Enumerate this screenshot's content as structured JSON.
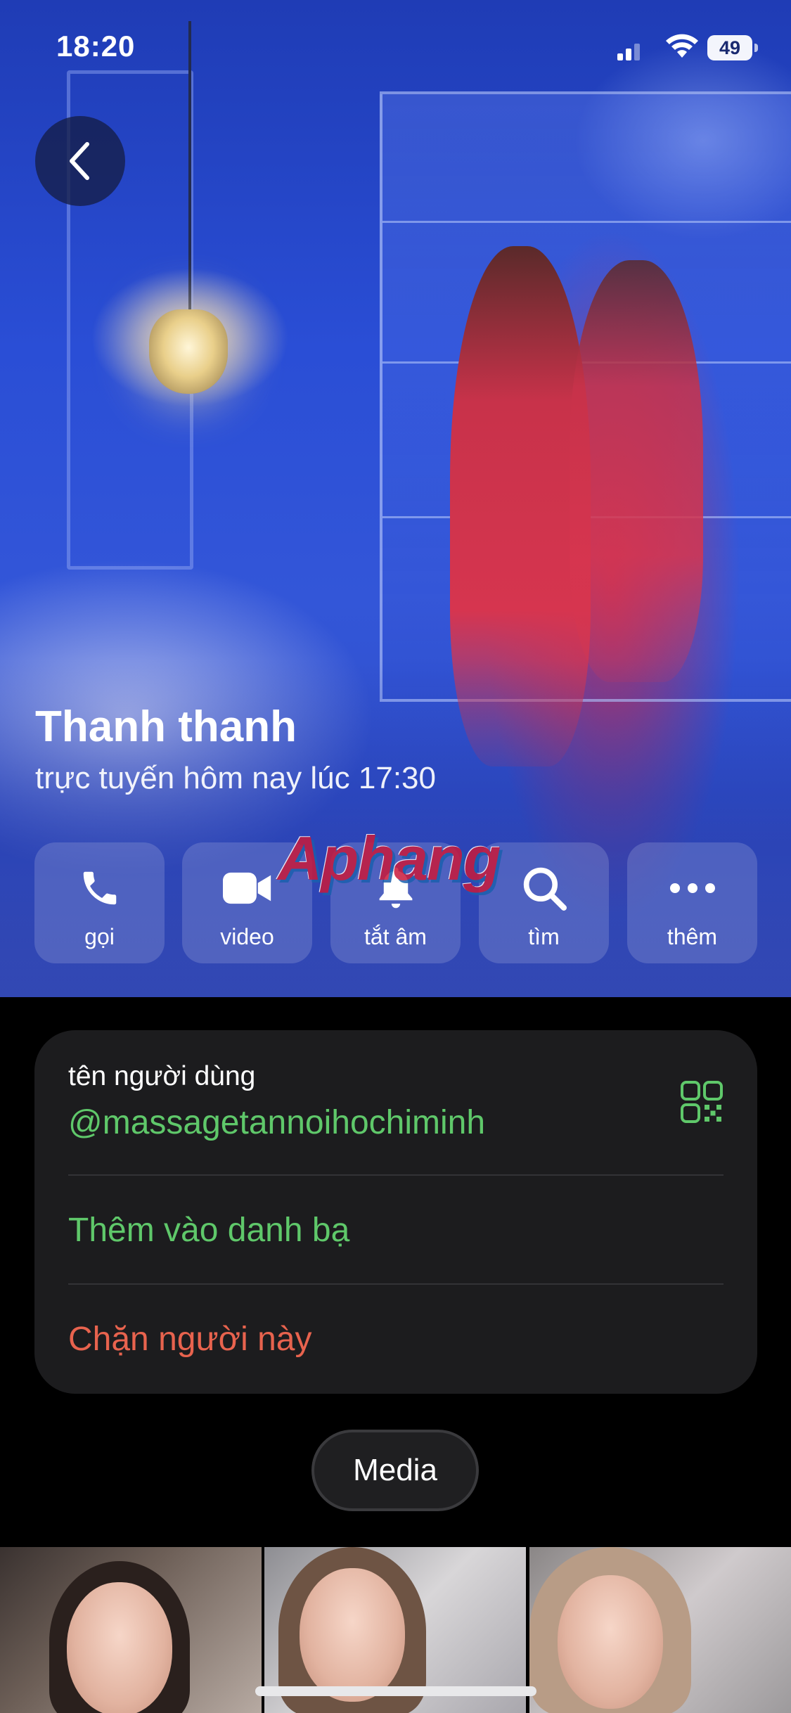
{
  "status_bar": {
    "time": "18:20",
    "battery": "49"
  },
  "profile": {
    "name": "Thanh thanh",
    "status": "trực tuyến hôm nay lúc 17:30"
  },
  "watermark": "Aphang",
  "actions": [
    {
      "label": "gọi",
      "icon": "phone-icon"
    },
    {
      "label": "video",
      "icon": "video-camera-icon"
    },
    {
      "label": "tắt âm",
      "icon": "bell-icon"
    },
    {
      "label": "tìm",
      "icon": "search-icon"
    },
    {
      "label": "thêm",
      "icon": "more-icon"
    }
  ],
  "info": {
    "username_label": "tên người dùng",
    "username": "@massagetannoihochiminh",
    "add_contact": "Thêm vào danh bạ",
    "block": "Chặn người này"
  },
  "media": {
    "button_label": "Media"
  },
  "colors": {
    "accent_green": "#5fc86a",
    "destructive_red": "#e8634e",
    "card_background": "#1c1c1e",
    "hero_blue": "#2a4ed6"
  }
}
